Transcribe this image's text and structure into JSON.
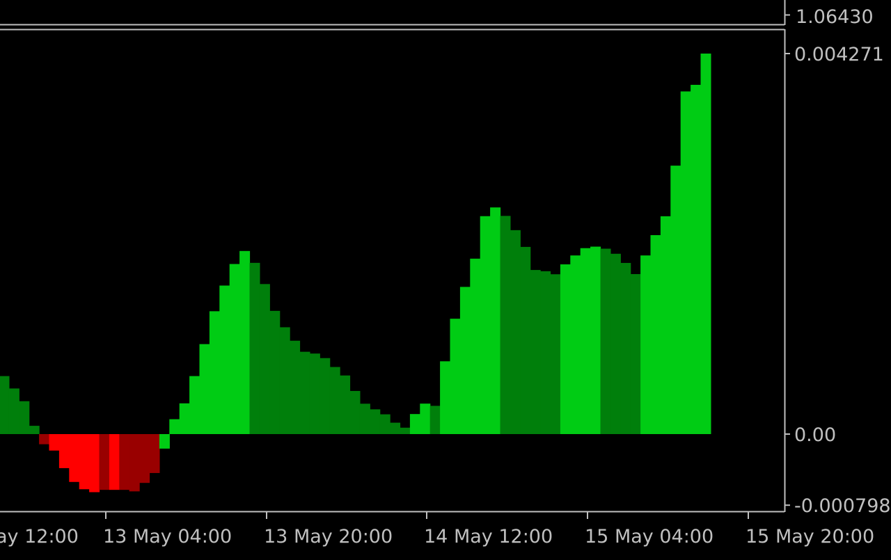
{
  "chart_data": [
    {
      "type": "line",
      "panel": "price",
      "axis_labels": [
        "1.06430"
      ],
      "y_tick_values": [
        1.0643
      ],
      "colors": {
        "background": "#000000",
        "axis": "#c0c0c0",
        "text": "#c0c0c0"
      }
    },
    {
      "type": "bar",
      "panel": "histogram-oscillator",
      "ylim": [
        -0.000798,
        0.004271
      ],
      "y_ticks": [
        {
          "value": 0.004271,
          "label": "0.004271"
        },
        {
          "value": 0.0,
          "label": "0.00"
        },
        {
          "value": -0.000798,
          "label": "-0.000798"
        }
      ],
      "x_tick_labels": [
        "ay 12:00",
        "13 May 04:00",
        "13 May 20:00",
        "14 May 12:00",
        "15 May 04:00",
        "15 May 20:00"
      ],
      "color_legend": {
        "up-positive": "#00cc14",
        "down-positive": "#007f0b",
        "down-negative": "#ff0000",
        "up-negative": "#990000"
      },
      "values": [
        0.000651,
        0.000512,
        0.000369,
        9.3e-05,
        -0.000114,
        -0.000185,
        -0.000382,
        -0.000537,
        -0.000619,
        -0.000652,
        -0.000626,
        -0.000626,
        -0.000626,
        -0.000643,
        -0.000548,
        -0.000437,
        -0.000163,
        0.000167,
        0.000345,
        0.000651,
        0.00101,
        0.001379,
        0.001667,
        0.001909,
        0.002055,
        0.001922,
        0.001684,
        0.001383,
        0.001199,
        0.001048,
        0.000924,
        0.000904,
        0.000853,
        0.000753,
        0.000658,
        0.000484,
        0.000341,
        0.000278,
        0.000222,
        0.000128,
        7.2e-05,
        0.000225,
        0.000342,
        0.000317,
        0.000817,
        0.001295,
        0.001652,
        0.001969,
        0.002446,
        0.002544,
        0.002449,
        0.002289,
        0.002101,
        0.001842,
        0.001828,
        0.001794,
        0.001905,
        0.002005,
        0.002087,
        0.002104,
        0.002081,
        0.002024,
        0.001921,
        0.001796,
        0.002005,
        0.002233,
        0.002445,
        0.003013,
        0.003846,
        0.00392,
        0.004271
      ],
      "colors": [
        "down-positive",
        "down-positive",
        "down-positive",
        "down-positive",
        "up-negative",
        "down-negative",
        "down-negative",
        "down-negative",
        "down-negative",
        "down-negative",
        "up-negative",
        "down-negative",
        "up-negative",
        "up-negative",
        "up-negative",
        "up-negative",
        "up-positive",
        "up-positive",
        "up-positive",
        "up-positive",
        "up-positive",
        "up-positive",
        "up-positive",
        "up-positive",
        "up-positive",
        "down-positive",
        "down-positive",
        "down-positive",
        "down-positive",
        "down-positive",
        "down-positive",
        "down-positive",
        "down-positive",
        "down-positive",
        "down-positive",
        "down-positive",
        "down-positive",
        "down-positive",
        "down-positive",
        "down-positive",
        "down-positive",
        "up-positive",
        "up-positive",
        "down-positive",
        "up-positive",
        "up-positive",
        "up-positive",
        "up-positive",
        "up-positive",
        "up-positive",
        "down-positive",
        "down-positive",
        "down-positive",
        "down-positive",
        "down-positive",
        "down-positive",
        "up-positive",
        "up-positive",
        "up-positive",
        "up-positive",
        "down-positive",
        "down-positive",
        "down-positive",
        "down-positive",
        "up-positive",
        "up-positive",
        "up-positive",
        "up-positive",
        "up-positive",
        "up-positive",
        "up-positive"
      ],
      "grid": false
    }
  ]
}
